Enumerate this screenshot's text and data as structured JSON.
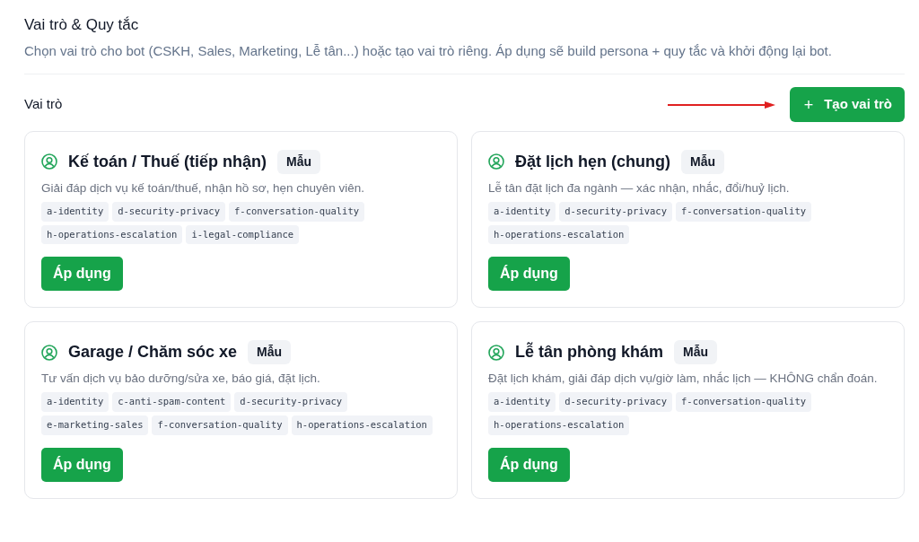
{
  "header": {
    "title": "Vai trò & Quy tắc",
    "description": "Chọn vai trò cho bot (CSKH, Sales, Marketing, Lễ tân...) hoặc tạo vai trò riêng. Áp dụng sẽ build persona + quy tắc và khởi động lại bot."
  },
  "section": {
    "label": "Vai trò",
    "create_button": {
      "icon": "+",
      "label": "Tạo vai trò"
    }
  },
  "roles": [
    {
      "title": "Kế toán / Thuế (tiếp nhận)",
      "badge": "Mẫu",
      "description": "Giải đáp dịch vụ kế toán/thuế, nhận hồ sơ, hẹn chuyên viên.",
      "tags": [
        "a-identity",
        "d-security-privacy",
        "f-conversation-quality",
        "h-operations-escalation",
        "i-legal-compliance"
      ],
      "button": "Áp dụng"
    },
    {
      "title": "Đặt lịch hẹn (chung)",
      "badge": "Mẫu",
      "description": "Lễ tân đặt lịch đa ngành — xác nhận, nhắc, đổi/huỷ lịch.",
      "tags": [
        "a-identity",
        "d-security-privacy",
        "f-conversation-quality",
        "h-operations-escalation"
      ],
      "button": "Áp dụng"
    },
    {
      "title": "Garage / Chăm sóc xe",
      "badge": "Mẫu",
      "description": "Tư vấn dịch vụ bảo dưỡng/sửa xe, báo giá, đặt lịch.",
      "tags": [
        "a-identity",
        "c-anti-spam-content",
        "d-security-privacy",
        "e-marketing-sales",
        "f-conversation-quality",
        "h-operations-escalation"
      ],
      "button": "Áp dụng"
    },
    {
      "title": "Lễ tân phòng khám",
      "badge": "Mẫu",
      "description": "Đặt lịch khám, giải đáp dịch vụ/giờ làm, nhắc lịch — KHÔNG chẩn đoán.",
      "tags": [
        "a-identity",
        "d-security-privacy",
        "f-conversation-quality",
        "h-operations-escalation"
      ],
      "button": "Áp dụng"
    }
  ]
}
